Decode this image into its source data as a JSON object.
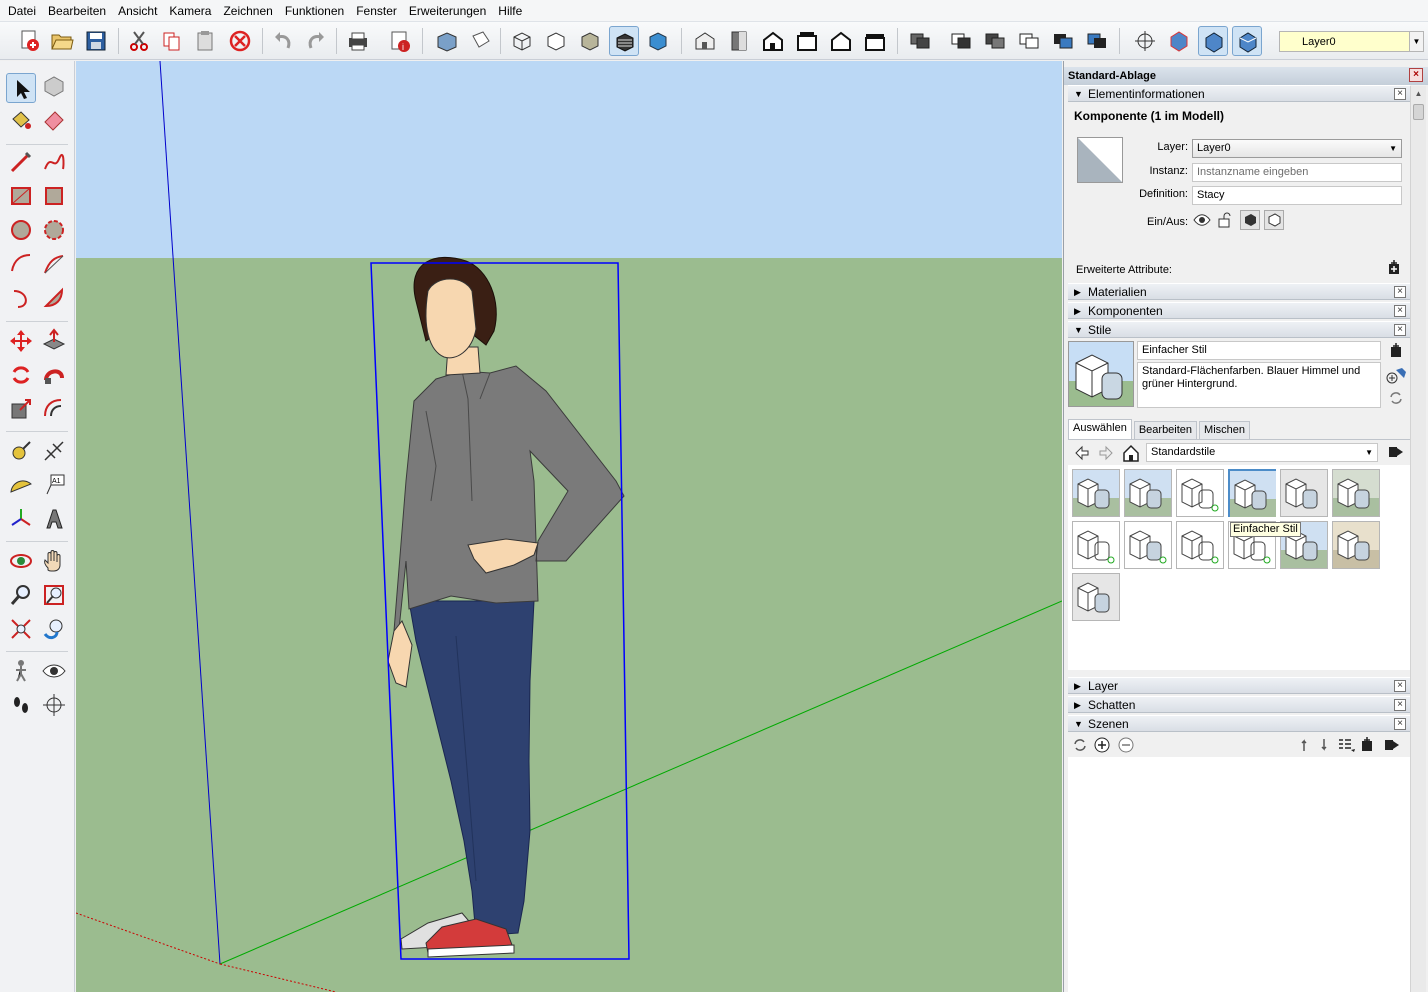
{
  "menu": [
    "Datei",
    "Bearbeiten",
    "Ansicht",
    "Kamera",
    "Zeichnen",
    "Funktionen",
    "Fenster",
    "Erweiterungen",
    "Hilfe"
  ],
  "toolbar": {
    "layer_value": "Layer0"
  },
  "panel": {
    "title": "Standard-Ablage",
    "entity_info": {
      "header": "Elementinformationen",
      "type_label": "Komponente (1 im Modell)",
      "layer_label": "Layer:",
      "layer_value": "Layer0",
      "instance_label": "Instanz:",
      "instance_placeholder": "Instanzname eingeben",
      "definition_label": "Definition:",
      "definition_value": "Stacy",
      "toggle_label": "Ein/Aus:",
      "advanced_label": "Erweiterte Attribute:"
    },
    "sections_collapsed_top": [
      "Materialien",
      "Komponenten"
    ],
    "styles": {
      "header": "Stile",
      "name": "Einfacher Stil",
      "description": "Standard-Flächenfarben. Blauer Himmel und grüner Hintergrund.",
      "tabs": [
        "Auswählen",
        "Bearbeiten",
        "Mischen"
      ],
      "active_tab": "Auswählen",
      "collection": "Standardstile",
      "tooltip": "Einfacher Stil",
      "thumb_count": 13,
      "selected_index": 3
    },
    "sections_bottom": [
      "Layer",
      "Schatten",
      "Szenen"
    ]
  },
  "colors": {
    "sky": "#c3ddf7",
    "ground": "#9bbc8f",
    "selection": "#0000ff"
  }
}
